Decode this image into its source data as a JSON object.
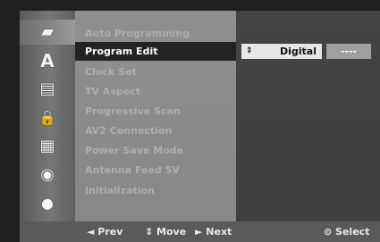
{
  "sidebar": {
    "items": [
      {
        "icon": "disc-icon",
        "glyph": "▰",
        "active": true
      },
      {
        "icon": "language-icon",
        "glyph": "A",
        "active": false
      },
      {
        "icon": "display-icon",
        "glyph": "▤",
        "active": false
      },
      {
        "icon": "lock-icon",
        "glyph": "🔒",
        "active": false
      },
      {
        "icon": "film-icon",
        "glyph": "▦",
        "active": false
      },
      {
        "icon": "dvd-icon",
        "glyph": "◉",
        "active": false
      },
      {
        "icon": "speaker-icon",
        "glyph": "●",
        "active": false
      }
    ]
  },
  "menu": {
    "items": [
      {
        "label": "Auto Programming",
        "selected": false
      },
      {
        "label": "Program Edit",
        "selected": true
      },
      {
        "label": "Clock Set",
        "selected": false
      },
      {
        "label": "TV Aspect",
        "selected": false
      },
      {
        "label": "Progressive Scan",
        "selected": false
      },
      {
        "label": "AV2 Connection",
        "selected": false
      },
      {
        "label": "Power Save Mode",
        "selected": false
      },
      {
        "label": "Antenna Feed 5V",
        "selected": false
      },
      {
        "label": "Initialization",
        "selected": false
      }
    ]
  },
  "option": {
    "arrow_glyph": "⇕",
    "value": "Digital",
    "secondary_value": "----"
  },
  "bottom": {
    "prev": "◄ Prev",
    "move": "⇕ Move",
    "next": "► Next",
    "select": "⊙ Select"
  },
  "colors": {
    "panel_gray": "#8f8f8f",
    "highlight": "#232323",
    "option_bg": "#e6e6e6"
  }
}
